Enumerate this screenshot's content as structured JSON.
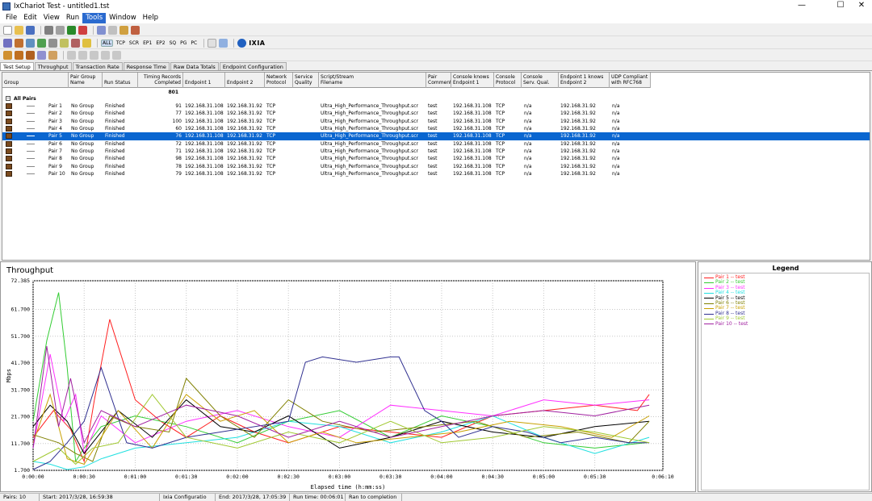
{
  "window": {
    "title": "IxChariot Test - untitled1.tst",
    "minimize": "—",
    "maximize": "☐",
    "close": "✕"
  },
  "menu": [
    "File",
    "Edit",
    "View",
    "Run",
    "Tools",
    "Window",
    "Help"
  ],
  "menu_active": "Tools",
  "toolbar2_text": {
    "all": "ALL",
    "tcp": "TCP",
    "scr": "SCR",
    "ep1": "EP1",
    "ep2": "EP2",
    "sq": "SQ",
    "pg": "PG",
    "pc": "PC",
    "ixia": "IXIA"
  },
  "tabs": [
    "Test Setup",
    "Throughput",
    "Transaction Rate",
    "Response Time",
    "Raw Data Totals",
    "Endpoint Configuration"
  ],
  "selected_tab": "Test Setup",
  "grid": {
    "headers": {
      "group": "Group",
      "pair_group_name": [
        "Pair Group",
        "Name"
      ],
      "run_status": "Run Status",
      "timing_records": [
        "Timing Records",
        "Completed"
      ],
      "endpoint1": "Endpoint 1",
      "endpoint2": "Endpoint 2",
      "network_protocol": [
        "Network",
        "Protocol"
      ],
      "service_quality": [
        "Service",
        "Quality"
      ],
      "script_filename": [
        "Script/Stream",
        "Filename"
      ],
      "pair_comment": [
        "Pair",
        "Comment"
      ],
      "console_knows_ep1": [
        "Console knows",
        "Endpoint 1"
      ],
      "console_protocol": [
        "Console",
        "Protocol"
      ],
      "console_serv_qual": [
        "Console",
        "Serv. Qual."
      ],
      "ep1_knows_ep2": [
        "Endpoint 1 knows",
        "Endpoint 2"
      ],
      "udp_compliant": [
        "UDP Compliant",
        "with RFC768"
      ]
    },
    "total_records": "801",
    "all_pairs_label": "All Pairs",
    "rows": [
      {
        "name": "Pair 1",
        "group": "No Group",
        "status": "Finished",
        "records": "91",
        "ep1": "192.168.31.108",
        "ep2": "192.168.31.92",
        "proto": "TCP",
        "script": "Ultra_High_Performance_Throughput.scr",
        "comment": "test",
        "cke1": "192.168.31.108",
        "cproto": "TCP",
        "csq": "n/a",
        "e1ke2": "192.168.31.92",
        "udp": "n/a"
      },
      {
        "name": "Pair 2",
        "group": "No Group",
        "status": "Finished",
        "records": "77",
        "ep1": "192.168.31.108",
        "ep2": "192.168.31.92",
        "proto": "TCP",
        "script": "Ultra_High_Performance_Throughput.scr",
        "comment": "test",
        "cke1": "192.168.31.108",
        "cproto": "TCP",
        "csq": "n/a",
        "e1ke2": "192.168.31.92",
        "udp": "n/a"
      },
      {
        "name": "Pair 3",
        "group": "No Group",
        "status": "Finished",
        "records": "100",
        "ep1": "192.168.31.108",
        "ep2": "192.168.31.92",
        "proto": "TCP",
        "script": "Ultra_High_Performance_Throughput.scr",
        "comment": "test",
        "cke1": "192.168.31.108",
        "cproto": "TCP",
        "csq": "n/a",
        "e1ke2": "192.168.31.92",
        "udp": "n/a"
      },
      {
        "name": "Pair 4",
        "group": "No Group",
        "status": "Finished",
        "records": "60",
        "ep1": "192.168.31.108",
        "ep2": "192.168.31.92",
        "proto": "TCP",
        "script": "Ultra_High_Performance_Throughput.scr",
        "comment": "test",
        "cke1": "192.168.31.108",
        "cproto": "TCP",
        "csq": "n/a",
        "e1ke2": "192.168.31.92",
        "udp": "n/a"
      },
      {
        "name": "Pair 5",
        "group": "No Group",
        "status": "Finished",
        "records": "76",
        "ep1": "192.168.31.108",
        "ep2": "192.168.31.92",
        "proto": "TCP",
        "script": "Ultra_High_Performance_Throughput.scr",
        "comment": "test",
        "cke1": "192.168.31.108",
        "cproto": "TCP",
        "csq": "n/a",
        "e1ke2": "192.168.31.92",
        "udp": "n/a"
      },
      {
        "name": "Pair 6",
        "group": "No Group",
        "status": "Finished",
        "records": "72",
        "ep1": "192.168.31.108",
        "ep2": "192.168.31.92",
        "proto": "TCP",
        "script": "Ultra_High_Performance_Throughput.scr",
        "comment": "test",
        "cke1": "192.168.31.108",
        "cproto": "TCP",
        "csq": "n/a",
        "e1ke2": "192.168.31.92",
        "udp": "n/a"
      },
      {
        "name": "Pair 7",
        "group": "No Group",
        "status": "Finished",
        "records": "71",
        "ep1": "192.168.31.108",
        "ep2": "192.168.31.92",
        "proto": "TCP",
        "script": "Ultra_High_Performance_Throughput.scr",
        "comment": "test",
        "cke1": "192.168.31.108",
        "cproto": "TCP",
        "csq": "n/a",
        "e1ke2": "192.168.31.92",
        "udp": "n/a"
      },
      {
        "name": "Pair 8",
        "group": "No Group",
        "status": "Finished",
        "records": "98",
        "ep1": "192.168.31.108",
        "ep2": "192.168.31.92",
        "proto": "TCP",
        "script": "Ultra_High_Performance_Throughput.scr",
        "comment": "test",
        "cke1": "192.168.31.108",
        "cproto": "TCP",
        "csq": "n/a",
        "e1ke2": "192.168.31.92",
        "udp": "n/a"
      },
      {
        "name": "Pair 9",
        "group": "No Group",
        "status": "Finished",
        "records": "78",
        "ep1": "192.168.31.108",
        "ep2": "192.168.31.92",
        "proto": "TCP",
        "script": "Ultra_High_Performance_Throughput.scr",
        "comment": "test",
        "cke1": "192.168.31.108",
        "cproto": "TCP",
        "csq": "n/a",
        "e1ke2": "192.168.31.92",
        "udp": "n/a"
      },
      {
        "name": "Pair 10",
        "group": "No Group",
        "status": "Finished",
        "records": "79",
        "ep1": "192.168.31.108",
        "ep2": "192.168.31.92",
        "proto": "TCP",
        "script": "Ultra_High_Performance_Throughput.scr",
        "comment": "test",
        "cke1": "192.168.31.108",
        "cproto": "TCP",
        "csq": "n/a",
        "e1ke2": "192.168.31.92",
        "udp": "n/a"
      }
    ],
    "selected_row": 4
  },
  "chart_data": {
    "type": "line",
    "title": "Throughput",
    "xlabel": "Elapsed time (h:mm:ss)",
    "ylabel": "Mbps",
    "ylim": [
      1.7,
      72.385
    ],
    "yticks": [
      "72.385",
      "61.700",
      "51.700",
      "41.700",
      "31.700",
      "21.700",
      "11.700",
      "1.700"
    ],
    "xlim": [
      "0:00:00",
      "0:06:10"
    ],
    "xticks": [
      "0:00:00",
      "0:00:30",
      "0:01:00",
      "0:01:30",
      "0:02:00",
      "0:02:30",
      "0:03:00",
      "0:03:30",
      "0:04:00",
      "0:04:30",
      "0:05:00",
      "0:05:30",
      "0:06:10"
    ],
    "grid": true,
    "legend": "right panel",
    "series": [
      {
        "name": "Pair 1 -- test",
        "color": "#ff2020",
        "x": [
          0,
          12,
          22,
          30,
          36,
          45,
          60,
          75,
          90,
          110,
          130,
          150,
          180,
          210,
          240,
          270,
          300,
          330,
          355,
          362
        ],
        "y": [
          14,
          24,
          17,
          5,
          28,
          58,
          28,
          20,
          14,
          22,
          16,
          12,
          18,
          16,
          14,
          22,
          24,
          26,
          24,
          30
        ]
      },
      {
        "name": "Pair 2 -- test",
        "color": "#33cc33",
        "x": [
          0,
          8,
          15,
          20,
          25,
          30,
          40,
          60,
          90,
          120,
          150,
          180,
          210,
          240,
          270,
          300,
          330,
          360
        ],
        "y": [
          20,
          50,
          68,
          40,
          5,
          10,
          18,
          22,
          18,
          12,
          20,
          24,
          14,
          22,
          18,
          12,
          10,
          12
        ]
      },
      {
        "name": "Pair 3 -- test",
        "color": "#ff30ff",
        "x": [
          0,
          10,
          18,
          25,
          30,
          40,
          60,
          90,
          120,
          150,
          180,
          210,
          240,
          270,
          300,
          330,
          362
        ],
        "y": [
          10,
          45,
          20,
          30,
          8,
          22,
          12,
          20,
          24,
          18,
          14,
          26,
          24,
          22,
          28,
          26,
          28
        ]
      },
      {
        "name": "Pair 4 -- test",
        "color": "#20e0e0",
        "x": [
          0,
          10,
          20,
          30,
          40,
          60,
          90,
          120,
          150,
          180,
          210,
          240,
          270,
          300,
          330,
          362
        ],
        "y": [
          5,
          4,
          2,
          3,
          6,
          10,
          12,
          14,
          20,
          18,
          12,
          16,
          22,
          14,
          8,
          14
        ]
      },
      {
        "name": "Pair 5 -- test",
        "color": "#000000",
        "x": [
          0,
          10,
          20,
          30,
          50,
          70,
          90,
          110,
          130,
          150,
          180,
          210,
          240,
          270,
          300,
          330,
          362
        ],
        "y": [
          18,
          26,
          20,
          8,
          24,
          14,
          28,
          18,
          16,
          22,
          10,
          14,
          20,
          16,
          14,
          18,
          20
        ]
      },
      {
        "name": "Pair 6 -- test",
        "color": "#808000",
        "x": [
          0,
          15,
          25,
          35,
          45,
          60,
          80,
          90,
          110,
          130,
          150,
          170,
          200,
          230,
          260,
          290,
          320,
          350,
          362
        ],
        "y": [
          15,
          12,
          8,
          5,
          22,
          18,
          16,
          36,
          22,
          14,
          28,
          20,
          16,
          18,
          20,
          14,
          16,
          12,
          20
        ]
      },
      {
        "name": "Pair 7 -- test",
        "color": "#c8a000",
        "x": [
          0,
          10,
          20,
          30,
          50,
          70,
          90,
          110,
          130,
          150,
          170,
          190,
          220,
          250,
          280,
          310,
          340,
          362
        ],
        "y": [
          12,
          30,
          6,
          4,
          24,
          10,
          30,
          20,
          24,
          12,
          16,
          12,
          14,
          16,
          20,
          18,
          14,
          22
        ]
      },
      {
        "name": "Pair 8 -- test",
        "color": "#303090",
        "x": [
          0,
          10,
          20,
          30,
          40,
          55,
          70,
          90,
          110,
          150,
          160,
          170,
          190,
          210,
          215,
          230,
          240,
          250,
          270,
          290,
          310,
          330,
          350,
          362
        ],
        "y": [
          2,
          5,
          12,
          20,
          40,
          12,
          10,
          14,
          16,
          20,
          42,
          44,
          42,
          44,
          44,
          24,
          20,
          14,
          18,
          16,
          12,
          14,
          12,
          12
        ]
      },
      {
        "name": "Pair 9 -- test",
        "color": "#a0c830",
        "x": [
          0,
          15,
          25,
          35,
          50,
          70,
          90,
          120,
          150,
          180,
          210,
          240,
          270,
          300,
          330,
          362
        ],
        "y": [
          5,
          10,
          4,
          10,
          12,
          30,
          14,
          10,
          16,
          12,
          20,
          12,
          14,
          18,
          16,
          12
        ]
      },
      {
        "name": "Pair 10 -- test",
        "color": "#a020a0",
        "x": [
          0,
          8,
          15,
          22,
          30,
          40,
          60,
          90,
          120,
          150,
          180,
          210,
          240,
          270,
          300,
          330,
          362
        ],
        "y": [
          10,
          48,
          18,
          36,
          12,
          24,
          18,
          26,
          22,
          14,
          20,
          14,
          18,
          22,
          24,
          22,
          26
        ]
      }
    ]
  },
  "legend_title": "Legend",
  "status": {
    "pairs": "Pairs: 10",
    "start": "Start: 2017/3/28, 16:59:38",
    "config": "Ixia Configuratio",
    "end": "End: 2017/3/28, 17:05:39",
    "runtime": "Run time: 00:06:01",
    "completion": "Ran to completion"
  }
}
